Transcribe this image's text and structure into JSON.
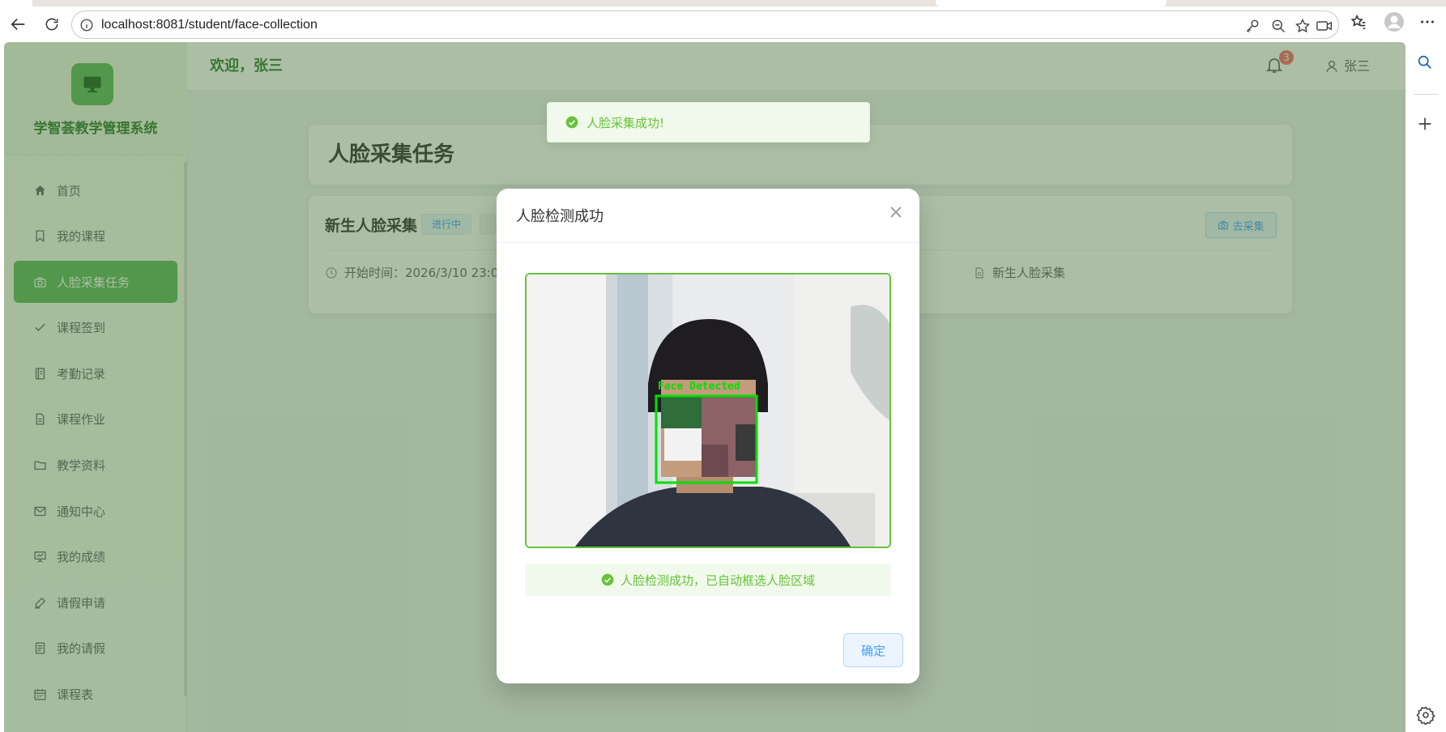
{
  "browser": {
    "url": "localhost:8081/student/face-collection"
  },
  "app": {
    "system_name": "学智荟教学管理系统",
    "welcome": "欢迎，张三",
    "notification_count": "3",
    "user_name": "张三"
  },
  "sidebar": {
    "items": [
      {
        "label": "首页",
        "icon": "home-icon"
      },
      {
        "label": "我的课程",
        "icon": "bookmark-icon"
      },
      {
        "label": "人脸采集任务",
        "icon": "camera-icon",
        "active": true
      },
      {
        "label": "课程签到",
        "icon": "check-icon"
      },
      {
        "label": "考勤记录",
        "icon": "notebook-icon"
      },
      {
        "label": "课程作业",
        "icon": "document-icon"
      },
      {
        "label": "教学资料",
        "icon": "folder-icon"
      },
      {
        "label": "通知中心",
        "icon": "message-icon"
      },
      {
        "label": "我的成绩",
        "icon": "data-board-icon"
      },
      {
        "label": "请假申请",
        "icon": "edit-pen-icon"
      },
      {
        "label": "我的请假",
        "icon": "tickets-icon"
      },
      {
        "label": "课程表",
        "icon": "calendar-icon"
      }
    ]
  },
  "page": {
    "title": "人脸采集任务",
    "task": {
      "title": "新生人脸采集",
      "status_tag": "进行中",
      "go_button": "去采集",
      "start_time": "开始时间：2026/3/10 23:04:",
      "description": "新生人脸采集"
    }
  },
  "toast": {
    "message": "人脸采集成功!"
  },
  "dialog": {
    "title": "人脸检测成功",
    "camera_label": "Face Detected",
    "message": "人脸检测成功，已自动框选人脸区域",
    "ok_button": "确定"
  },
  "colors": {
    "primary_green": "#5cb85c",
    "success": "#67c23a",
    "info_blue": "#409eff",
    "danger": "#f56c6c"
  }
}
